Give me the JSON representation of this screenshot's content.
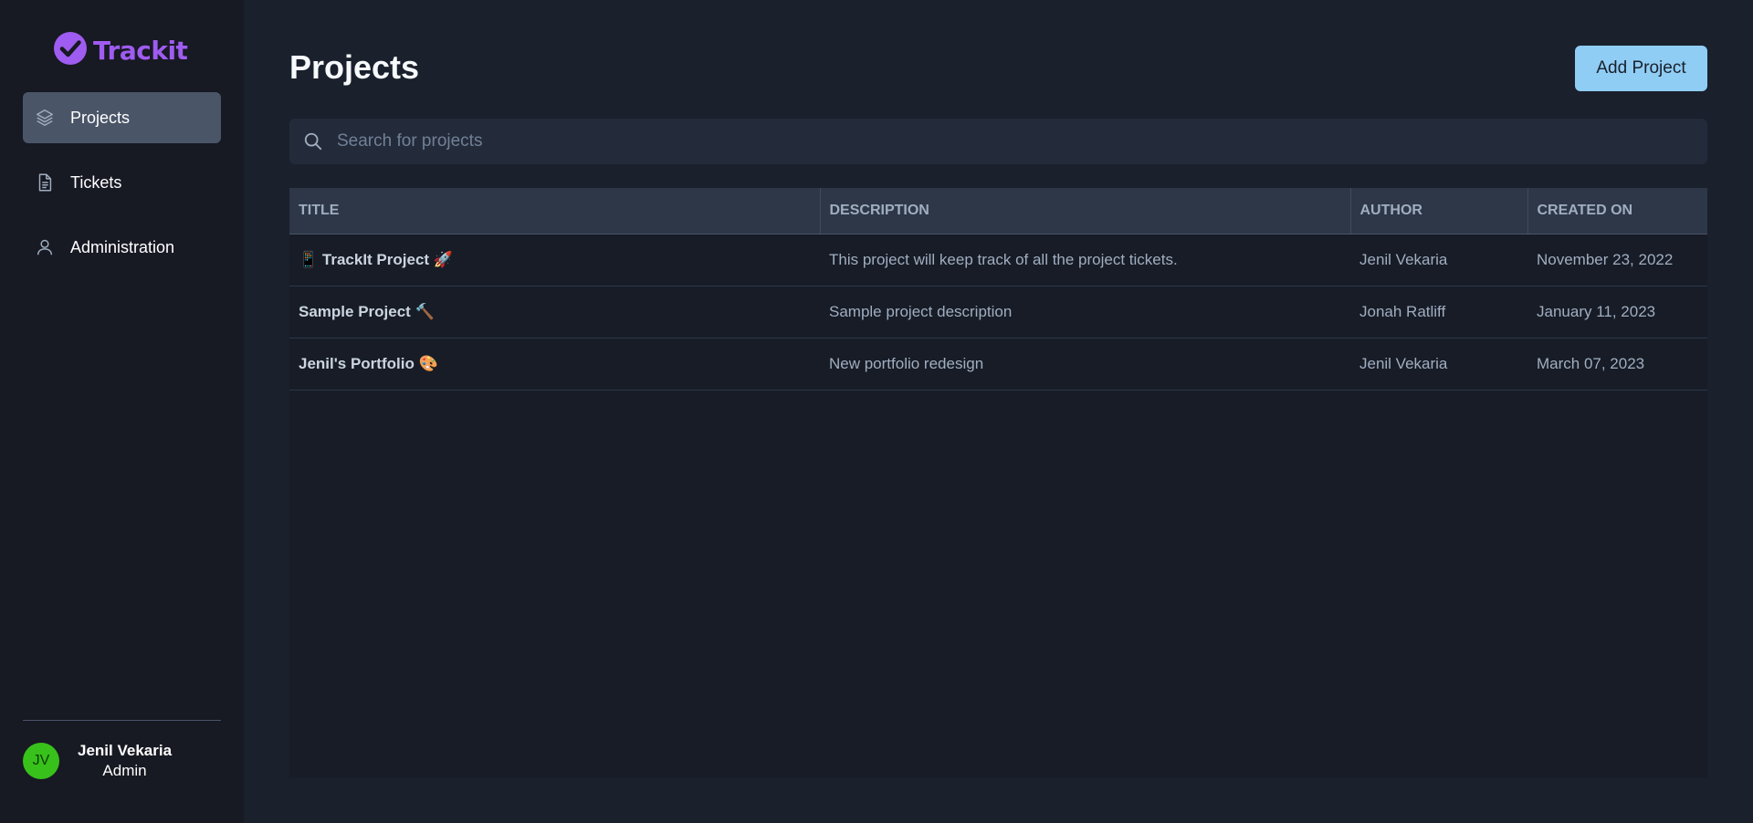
{
  "app": {
    "brand": "Trackit",
    "brand_color": "#9f5cf0"
  },
  "sidebar": {
    "items": [
      {
        "label": "Projects",
        "icon": "layers-icon",
        "active": true
      },
      {
        "label": "Tickets",
        "icon": "document-icon",
        "active": false
      },
      {
        "label": "Administration",
        "icon": "user-icon",
        "active": false
      }
    ],
    "user": {
      "initials": "JV",
      "name": "Jenil Vekaria",
      "role": "Admin"
    }
  },
  "header": {
    "title": "Projects",
    "add_label": "Add Project"
  },
  "search": {
    "placeholder": "Search for projects",
    "value": ""
  },
  "table": {
    "columns": [
      "TITLE",
      "DESCRIPTION",
      "AUTHOR",
      "CREATED ON"
    ],
    "rows": [
      {
        "title": "📱 TrackIt Project 🚀",
        "description": "This project will keep track of all the project tickets.",
        "author": "Jenil Vekaria",
        "created": "November 23, 2022"
      },
      {
        "title": "Sample Project 🔨",
        "description": "Sample project description",
        "author": "Jonah Ratliff",
        "created": "January 11, 2023"
      },
      {
        "title": "Jenil's Portfolio 🎨",
        "description": "New portfolio redesign",
        "author": "Jenil Vekaria",
        "created": "March 07, 2023"
      }
    ]
  }
}
